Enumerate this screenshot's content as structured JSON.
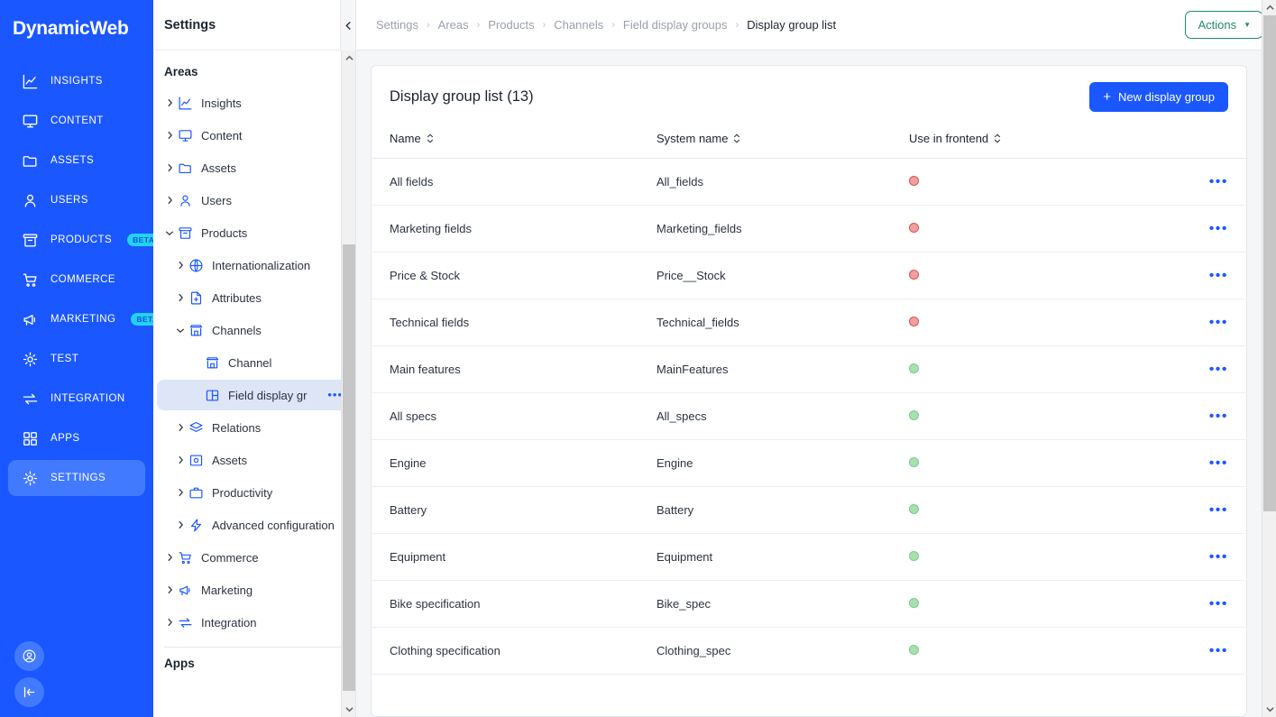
{
  "rail": {
    "brand": "DynamicWeb",
    "items": [
      {
        "label": "INSIGHTS",
        "icon": "insights-icon",
        "badge": null,
        "active": false
      },
      {
        "label": "CONTENT",
        "icon": "monitor-icon",
        "badge": null,
        "active": false
      },
      {
        "label": "ASSETS",
        "icon": "folder-icon",
        "badge": null,
        "active": false
      },
      {
        "label": "USERS",
        "icon": "user-icon",
        "badge": null,
        "active": false
      },
      {
        "label": "PRODUCTS",
        "icon": "box-icon",
        "badge": "BETA",
        "active": false
      },
      {
        "label": "COMMERCE",
        "icon": "cart-icon",
        "badge": null,
        "active": false
      },
      {
        "label": "MARKETING",
        "icon": "megaphone-icon",
        "badge": "BETA",
        "active": false
      },
      {
        "label": "TEST",
        "icon": "gear-icon",
        "badge": null,
        "active": false
      },
      {
        "label": "INTEGRATION",
        "icon": "exchange-icon",
        "badge": null,
        "active": false
      },
      {
        "label": "APPS",
        "icon": "grid-icon",
        "badge": null,
        "active": false
      },
      {
        "label": "SETTINGS",
        "icon": "gear-icon",
        "badge": null,
        "active": true
      }
    ],
    "bottom": [
      {
        "icon": "account-icon"
      },
      {
        "icon": "collapse-rail-icon"
      }
    ]
  },
  "tree": {
    "title": "Settings",
    "section_areas": "Areas",
    "section_apps": "Apps",
    "items": [
      {
        "label": "Insights",
        "icon": "insights-icon",
        "indent": 0,
        "chevron": "right",
        "selected": false,
        "dots": false
      },
      {
        "label": "Content",
        "icon": "monitor-icon",
        "indent": 0,
        "chevron": "right",
        "selected": false,
        "dots": false
      },
      {
        "label": "Assets",
        "icon": "folder-icon",
        "indent": 0,
        "chevron": "right",
        "selected": false,
        "dots": false
      },
      {
        "label": "Users",
        "icon": "user-icon",
        "indent": 0,
        "chevron": "right",
        "selected": false,
        "dots": false
      },
      {
        "label": "Products",
        "icon": "box-icon",
        "indent": 0,
        "chevron": "down",
        "selected": false,
        "dots": false
      },
      {
        "label": "Internationalization",
        "icon": "globe-icon",
        "indent": 1,
        "chevron": "right",
        "selected": false,
        "dots": false
      },
      {
        "label": "Attributes",
        "icon": "file-plus-icon",
        "indent": 1,
        "chevron": "right",
        "selected": false,
        "dots": false
      },
      {
        "label": "Channels",
        "icon": "store-icon",
        "indent": 1,
        "chevron": "down",
        "selected": false,
        "dots": false
      },
      {
        "label": "Channel",
        "icon": "store-icon",
        "indent": 2,
        "chevron": "none",
        "selected": false,
        "dots": false
      },
      {
        "label": "Field display gr",
        "icon": "layout-icon",
        "indent": 2,
        "chevron": "none",
        "selected": true,
        "dots": true
      },
      {
        "label": "Relations",
        "icon": "layers-icon",
        "indent": 1,
        "chevron": "right",
        "selected": false,
        "dots": false
      },
      {
        "label": "Assets",
        "icon": "image-icon",
        "indent": 1,
        "chevron": "right",
        "selected": false,
        "dots": false
      },
      {
        "label": "Productivity",
        "icon": "briefcase-icon",
        "indent": 1,
        "chevron": "right",
        "selected": false,
        "dots": false
      },
      {
        "label": "Advanced configuration",
        "icon": "bolt-icon",
        "indent": 1,
        "chevron": "right",
        "selected": false,
        "dots": false
      },
      {
        "label": "Commerce",
        "icon": "cart-icon",
        "indent": 0,
        "chevron": "right",
        "selected": false,
        "dots": false
      },
      {
        "label": "Marketing",
        "icon": "megaphone-icon",
        "indent": 0,
        "chevron": "right",
        "selected": false,
        "dots": false
      },
      {
        "label": "Integration",
        "icon": "exchange-icon",
        "indent": 0,
        "chevron": "right",
        "selected": false,
        "dots": false
      }
    ]
  },
  "topbar": {
    "breadcrumbs": [
      {
        "label": "Settings",
        "current": false
      },
      {
        "label": "Areas",
        "current": false
      },
      {
        "label": "Products",
        "current": false
      },
      {
        "label": "Channels",
        "current": false
      },
      {
        "label": "Field display groups",
        "current": false
      },
      {
        "label": "Display group list",
        "current": true
      }
    ],
    "separator": "›",
    "actions_label": "Actions",
    "actions_caret": "▼"
  },
  "card": {
    "title": "Display group list (13)",
    "new_button_label": "New display group",
    "new_button_plus": "+"
  },
  "table": {
    "columns": [
      {
        "label": "Name",
        "sortable": true
      },
      {
        "label": "System name",
        "sortable": true
      },
      {
        "label": "Use in frontend",
        "sortable": true
      },
      {
        "label": "",
        "sortable": false
      }
    ],
    "row_menu_glyph": "•••",
    "rows": [
      {
        "name": "All fields",
        "system_name": "All_fields",
        "use_in_frontend": "red"
      },
      {
        "name": "Marketing fields",
        "system_name": "Marketing_fields",
        "use_in_frontend": "red"
      },
      {
        "name": "Price & Stock",
        "system_name": "Price__Stock",
        "use_in_frontend": "red"
      },
      {
        "name": "Technical fields",
        "system_name": "Technical_fields",
        "use_in_frontend": "red"
      },
      {
        "name": "Main features",
        "system_name": "MainFeatures",
        "use_in_frontend": "green"
      },
      {
        "name": "All specs",
        "system_name": "All_specs",
        "use_in_frontend": "green"
      },
      {
        "name": "Engine",
        "system_name": "Engine",
        "use_in_frontend": "green"
      },
      {
        "name": "Battery",
        "system_name": "Battery",
        "use_in_frontend": "green"
      },
      {
        "name": "Equipment",
        "system_name": "Equipment",
        "use_in_frontend": "green"
      },
      {
        "name": "Bike specification",
        "system_name": "Bike_spec",
        "use_in_frontend": "green"
      },
      {
        "name": "Clothing specification",
        "system_name": "Clothing_spec",
        "use_in_frontend": "green"
      }
    ]
  },
  "colors": {
    "brand_blue": "#1A57FF",
    "actions_green": "#1E8B63",
    "badge_cyan": "#22D3EE",
    "status_red": "#D9534F",
    "status_green": "#7CC98B"
  }
}
